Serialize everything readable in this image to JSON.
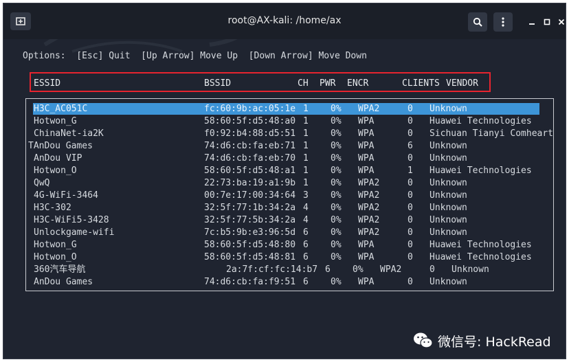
{
  "window": {
    "title": "root@AX-kali: /home/ax"
  },
  "terminal": {
    "options_line": "Options:  [Esc] Quit  [Up Arrow] Move Up  [Down Arrow] Move Down",
    "headers": {
      "essid": "ESSID",
      "bssid": "BSSID",
      "ch": "CH",
      "pwr": "PWR",
      "encr": "ENCR",
      "clients": "CLIENTS",
      "vendor": "VENDOR"
    },
    "rows": [
      {
        "essid": "H3C_AC051C",
        "bssid": "fc:60:9b:ac:05:1e",
        "ch": "1",
        "pwr": "0%",
        "encr": "WPA2",
        "clients": "0",
        "vendor": "Unknown",
        "selected": true
      },
      {
        "essid": "Hotwon_G",
        "bssid": "58:60:5f:d5:48:a0",
        "ch": "1",
        "pwr": "0%",
        "encr": "WPA",
        "clients": "0",
        "vendor": "Huawei Technologies"
      },
      {
        "essid": "ChinaNet-ia2K",
        "bssid": "f0:92:b4:88:d5:51",
        "ch": "1",
        "pwr": "0%",
        "encr": "WPA",
        "clients": "0",
        "vendor": "Sichuan Tianyi Comheart"
      },
      {
        "essid": "TAnDou Games",
        "bssid": "74:d6:cb:fa:eb:71",
        "ch": "1",
        "pwr": "0%",
        "encr": "WPA",
        "clients": "6",
        "vendor": "Unknown",
        "offset": "left"
      },
      {
        "essid": "AnDou VIP",
        "bssid": "74:d6:cb:fa:eb:70",
        "ch": "1",
        "pwr": "0%",
        "encr": "WPA",
        "clients": "0",
        "vendor": "Unknown"
      },
      {
        "essid": "Hotwon_O",
        "bssid": "58:60:5f:d5:48:a1",
        "ch": "1",
        "pwr": "0%",
        "encr": "WPA",
        "clients": "1",
        "vendor": "Huawei Technologies"
      },
      {
        "essid": "QwQ",
        "bssid": "22:73:ba:19:a1:9b",
        "ch": "1",
        "pwr": "0%",
        "encr": "WPA2",
        "clients": "0",
        "vendor": "Unknown"
      },
      {
        "essid": "4G-WiFi-3464",
        "bssid": "00:7e:17:00:34:64",
        "ch": "3",
        "pwr": "0%",
        "encr": "WPA2",
        "clients": "0",
        "vendor": "Unknown"
      },
      {
        "essid": "H3C-302",
        "bssid": "32:5f:77:1b:34:2a",
        "ch": "4",
        "pwr": "0%",
        "encr": "WPA2",
        "clients": "0",
        "vendor": "Unknown"
      },
      {
        "essid": "H3C-WiFi5-3428",
        "bssid": "32:5f:77:5b:34:2a",
        "ch": "4",
        "pwr": "0%",
        "encr": "WPA2",
        "clients": "0",
        "vendor": "Unknown"
      },
      {
        "essid": "Unlockgame-wifi",
        "bssid": "7c:b5:9b:e3:96:5d",
        "ch": "6",
        "pwr": "0%",
        "encr": "WPA2",
        "clients": "0",
        "vendor": "Unknown"
      },
      {
        "essid": "Hotwon_G",
        "bssid": "58:60:5f:d5:48:80",
        "ch": "6",
        "pwr": "0%",
        "encr": "WPA",
        "clients": "0",
        "vendor": "Huawei Technologies"
      },
      {
        "essid": "Hotwon_O",
        "bssid": "58:60:5f:d5:48:81",
        "ch": "6",
        "pwr": "0%",
        "encr": "WPA",
        "clients": "0",
        "vendor": "Huawei Technologies"
      },
      {
        "essid": "360汽车导航",
        "bssid": "2a:7f:cf:fc:14:b7",
        "ch": "6",
        "pwr": "0%",
        "encr": "WPA2",
        "clients": "0",
        "vendor": "Unknown",
        "offset": "right"
      },
      {
        "essid": "AnDou Games",
        "bssid": "74:d6:cb:fa:f9:51",
        "ch": "6",
        "pwr": "0%",
        "encr": "WPA",
        "clients": "0",
        "vendor": "Unknown"
      }
    ]
  },
  "watermark": {
    "text": "微信号: HackRead",
    "icon": "wechat-icon"
  },
  "colors": {
    "background": "#1f2430",
    "selection": "#3d95d8",
    "highlight_box": "#e8242f"
  }
}
